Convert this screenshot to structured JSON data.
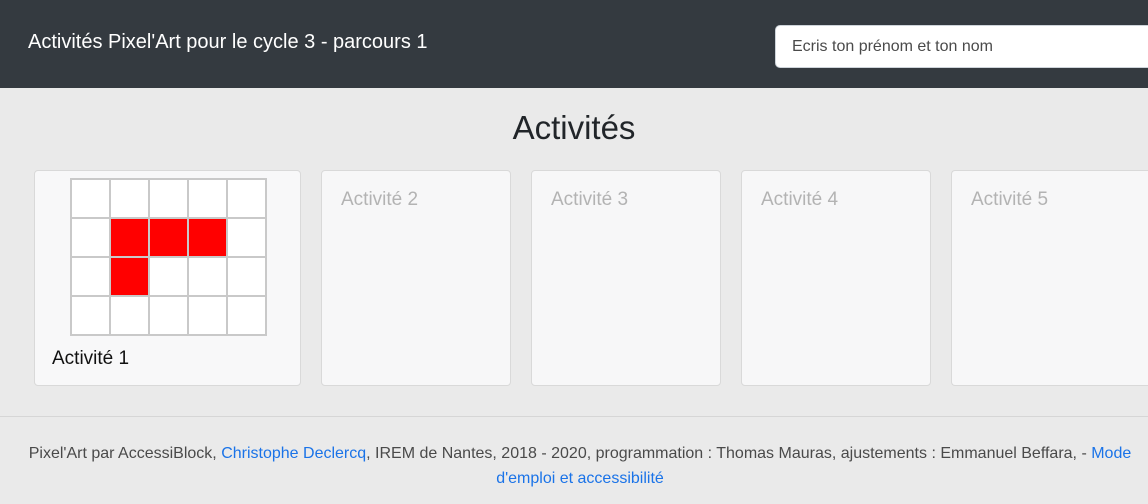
{
  "header": {
    "title": "Activités Pixel'Art pour le cycle 3 - parcours 1",
    "name_placeholder": "Ecris ton prénom et ton nom"
  },
  "main": {
    "heading": "Activités",
    "activities": [
      {
        "label": "Activité 1",
        "state": "active",
        "pixels": [
          [
            0,
            0,
            0,
            0,
            0
          ],
          [
            0,
            1,
            1,
            1,
            0
          ],
          [
            0,
            1,
            0,
            0,
            0
          ],
          [
            0,
            0,
            0,
            0,
            0
          ]
        ]
      },
      {
        "label": "Activité 2",
        "state": "locked"
      },
      {
        "label": "Activité 3",
        "state": "locked"
      },
      {
        "label": "Activité 4",
        "state": "locked"
      },
      {
        "label": "Activité 5",
        "state": "locked"
      }
    ],
    "pixel_color": "#ff0000"
  },
  "footer": {
    "text_1": "Pixel'Art par AccessiBlock, ",
    "link_author": "Christophe Declercq",
    "text_2": ", IREM de Nantes, 2018 - 2020, programmation : Thomas Mauras, ajustements : Emmanuel Beffara, - ",
    "link_help": "Mode d'emploi et accessibilité"
  },
  "colors": {
    "topbar": "#343a40",
    "background": "#eaeaea",
    "link": "#1a73e8"
  }
}
